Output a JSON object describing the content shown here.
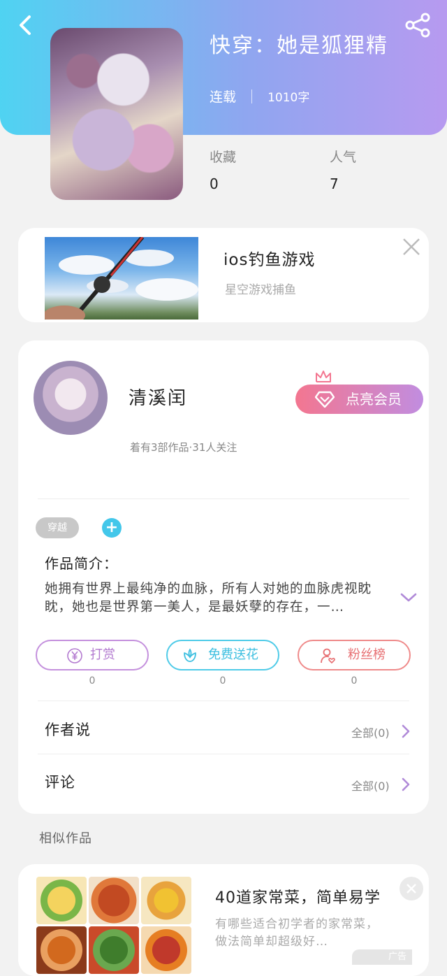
{
  "book": {
    "title": "快穿：她是狐狸精",
    "status": "连载",
    "word_count": "1010字",
    "stats": [
      {
        "label": "收藏",
        "value": "0"
      },
      {
        "label": "人气",
        "value": "7"
      }
    ]
  },
  "ad": {
    "title": "ios钓鱼游戏",
    "subtitle": "星空游戏捕鱼"
  },
  "author": {
    "name": "清溪闰",
    "meta": "着有3部作品·31人关注",
    "vip_label": "点亮会员"
  },
  "tags": [
    "穿越"
  ],
  "tag_add_symbol": "+",
  "intro": {
    "label": "作品简介：",
    "text": "她拥有世界上最纯净的血脉，所有人对她的血脉虎视眈眈，她也是世界第一美人，是最妖孽的存在，一…"
  },
  "actions": [
    {
      "label": "打赏",
      "icon": "yen-icon",
      "count": "0",
      "color": "#b37ad0"
    },
    {
      "label": "免费送花",
      "icon": "flower-icon",
      "count": "0",
      "color": "#3dbfe0"
    },
    {
      "label": "粉丝榜",
      "icon": "user-heart-icon",
      "count": "0",
      "color": "#e76f72"
    }
  ],
  "sections": [
    {
      "label": "作者说",
      "right": "全部(0)"
    },
    {
      "label": "评论",
      "right": "全部(0)"
    }
  ],
  "similar": {
    "label": "相似作品",
    "title": "40道家常菜，简单易学",
    "desc": "有哪些适合初学者的家常菜，做法简单却超级好…",
    "ad_badge": "广告"
  },
  "colors": {
    "header_start": "#4fd3f2",
    "header_end": "#b79af0",
    "vip_start": "#f37690",
    "vip_end": "#c18de0",
    "accent_blue": "#43c7ea"
  }
}
